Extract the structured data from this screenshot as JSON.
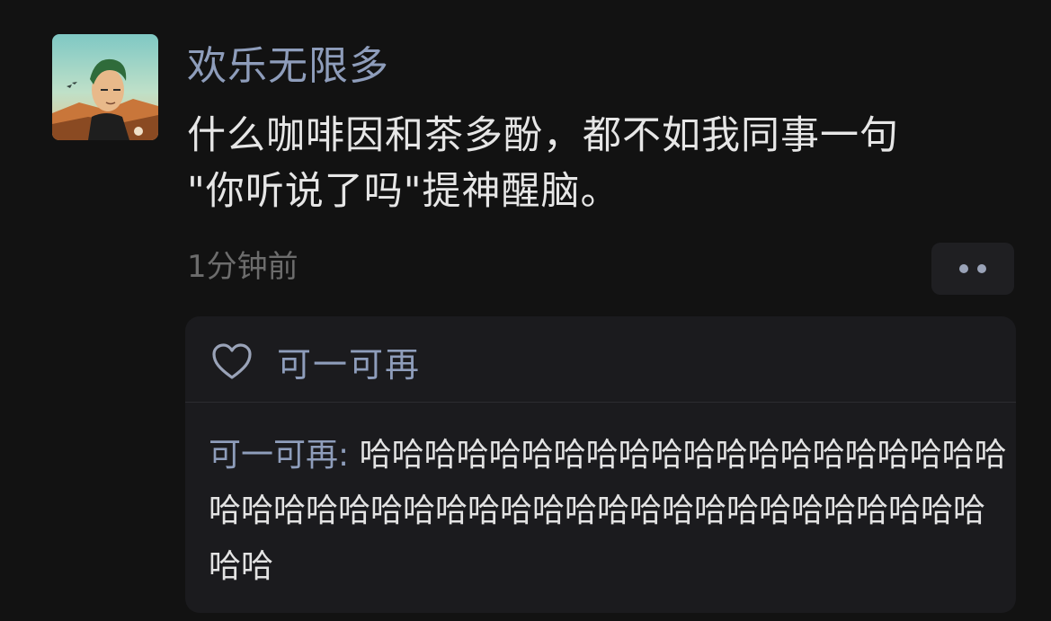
{
  "post": {
    "username": "欢乐无限多",
    "text_lines": [
      "什么咖啡因和茶多酚，都不如我同事一句",
      "\"你听说了吗\"提神醒脑。"
    ],
    "timestamp": "1分钟前",
    "avatar_icon": "anime-character-avatar",
    "more_icon": "more-dots-icon"
  },
  "reply_box": {
    "like_icon": "heart-outline-icon",
    "liker": "可一可再",
    "comment": {
      "author": "可一可再",
      "separator": ": ",
      "text": "哈哈哈哈哈哈哈哈哈哈哈哈哈哈哈哈哈哈哈哈哈哈哈哈哈哈哈哈哈哈哈哈哈哈哈哈哈哈哈哈哈哈哈哈哈哈"
    }
  },
  "colors": {
    "background": "#121212",
    "accent_name": "#8e9dbb",
    "body_text": "#e6e6e6",
    "muted_text": "#6c6c6c",
    "panel": "#1b1b1e"
  }
}
